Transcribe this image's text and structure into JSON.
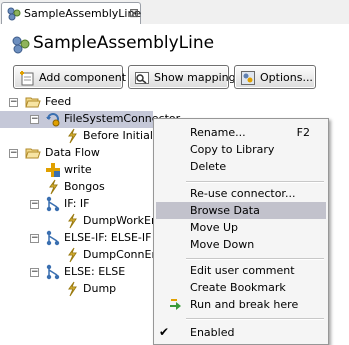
{
  "tab": {
    "label": "SampleAssemblyLine",
    "close": "⊠"
  },
  "header": {
    "title": "SampleAssemblyLine"
  },
  "toolbar": {
    "add_label": "Add component",
    "map_label": "Show mapping",
    "options_label": "Options..."
  },
  "tree": {
    "feed": "Feed",
    "connector": "FileSystemConnector",
    "before_init": "Before Initialize",
    "data_flow": "Data Flow",
    "write": "write",
    "bongos": "Bongos",
    "if": "IF: IF",
    "dump_work": "DumpWorkEntry",
    "else_if": "ELSE-IF: ELSE-IF",
    "dump_conn": "DumpConnEntry",
    "else": "ELSE: ELSE",
    "dump": "Dump"
  },
  "menu": {
    "rename": "Rename...",
    "rename_key": "F2",
    "copy_library": "Copy to Library",
    "delete": "Delete",
    "reuse": "Re-use connector...",
    "browse": "Browse Data",
    "move_up": "Move Up",
    "move_down": "Move Down",
    "edit_comment": "Edit user comment",
    "bookmark": "Create Bookmark",
    "run_break": "Run and break here",
    "enabled": "Enabled",
    "enabled_check": "✔"
  },
  "colors": {
    "selection": "#c5c8d8",
    "menu_highlight": "#c2c2cc",
    "folder": "#e8c25a",
    "flow_icon": "#3a6fb0",
    "script_icon": "#d9b038"
  }
}
